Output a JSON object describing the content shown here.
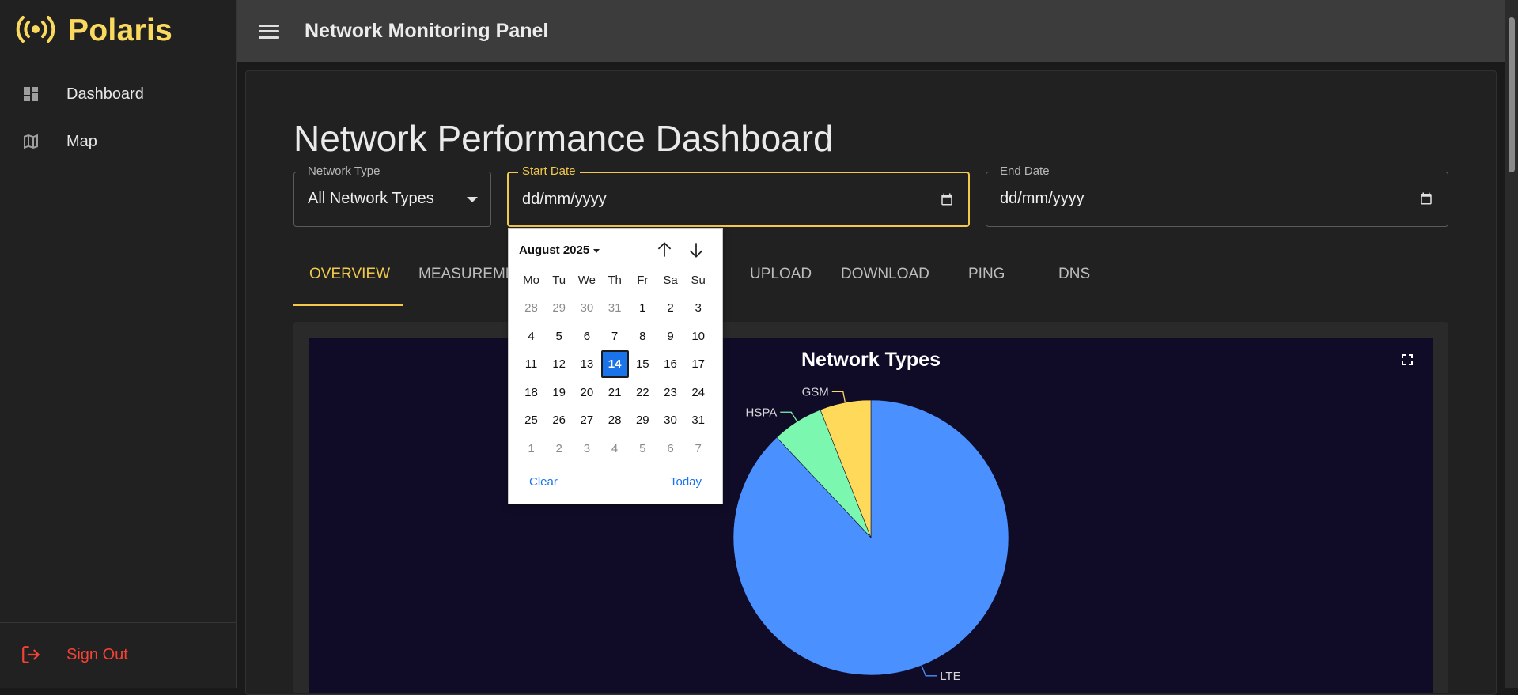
{
  "app": {
    "name": "Polaris",
    "header_title": "Network Monitoring Panel"
  },
  "sidebar": {
    "items": [
      {
        "label": "Dashboard",
        "icon": "dashboard-icon"
      },
      {
        "label": "Map",
        "icon": "map-icon"
      }
    ],
    "sign_out": {
      "label": "Sign Out",
      "icon": "logout-icon"
    }
  },
  "page": {
    "heading": "Network Performance Dashboard",
    "filters": {
      "network_type": {
        "label": "Network Type",
        "value": "All Network Types"
      },
      "start_date": {
        "label": "Start Date",
        "value": "dd/mm/yyyy"
      },
      "end_date": {
        "label": "End Date",
        "value": "dd/mm/yyyy"
      }
    },
    "tabs": [
      {
        "label": "OVERVIEW",
        "active": true
      },
      {
        "label": "MEASUREMENTS"
      },
      {
        "label": "UPLOAD"
      },
      {
        "label": "DOWNLOAD"
      },
      {
        "label": "PING"
      },
      {
        "label": "DNS"
      }
    ]
  },
  "date_picker": {
    "month_label": "August 2025",
    "weekdays": [
      "Mo",
      "Tu",
      "We",
      "Th",
      "Fr",
      "Sa",
      "Su"
    ],
    "weeks": [
      [
        28,
        29,
        30,
        31,
        1,
        2,
        3
      ],
      [
        4,
        5,
        6,
        7,
        8,
        9,
        10
      ],
      [
        11,
        12,
        13,
        14,
        15,
        16,
        17
      ],
      [
        18,
        19,
        20,
        21,
        22,
        23,
        24
      ],
      [
        25,
        26,
        27,
        28,
        29,
        30,
        31
      ],
      [
        1,
        2,
        3,
        4,
        5,
        6,
        7
      ]
    ],
    "selected_day": 14,
    "clear_label": "Clear",
    "today_label": "Today"
  },
  "colors": {
    "accent": "#f2c94c",
    "brand": "#fada5e",
    "danger": "#f44336",
    "selected_day": "#1a73e8",
    "chart_background": "#100c28"
  },
  "chart_data": {
    "type": "pie",
    "title": "Network Types",
    "labels": [
      "LTE",
      "HSPA",
      "GSM"
    ],
    "values": [
      88,
      6,
      6
    ],
    "colors": [
      "#4a90ff",
      "#7cf7b0",
      "#ffd95a"
    ]
  }
}
